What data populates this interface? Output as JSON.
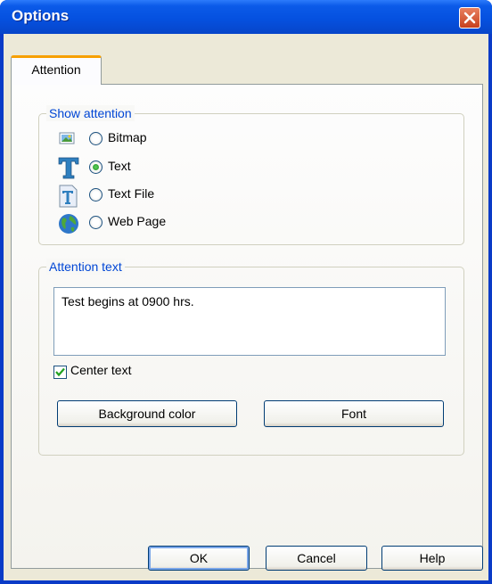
{
  "window": {
    "title": "Options"
  },
  "tabs": [
    {
      "label": "Attention"
    }
  ],
  "show_attention": {
    "title": "Show attention",
    "options": [
      {
        "label": "Bitmap",
        "icon": "bitmap-icon",
        "selected": false
      },
      {
        "label": "Text",
        "icon": "text-icon",
        "selected": true
      },
      {
        "label": "Text File",
        "icon": "text-file-icon",
        "selected": false
      },
      {
        "label": "Web Page",
        "icon": "globe-icon",
        "selected": false
      }
    ]
  },
  "attention_text": {
    "title": "Attention text",
    "value": "Test begins at 0900 hrs.",
    "center_text_label": "Center text",
    "center_text_checked": true,
    "background_color_label": "Background color",
    "font_label": "Font"
  },
  "footer": {
    "ok_label": "OK",
    "cancel_label": "Cancel",
    "help_label": "Help"
  }
}
